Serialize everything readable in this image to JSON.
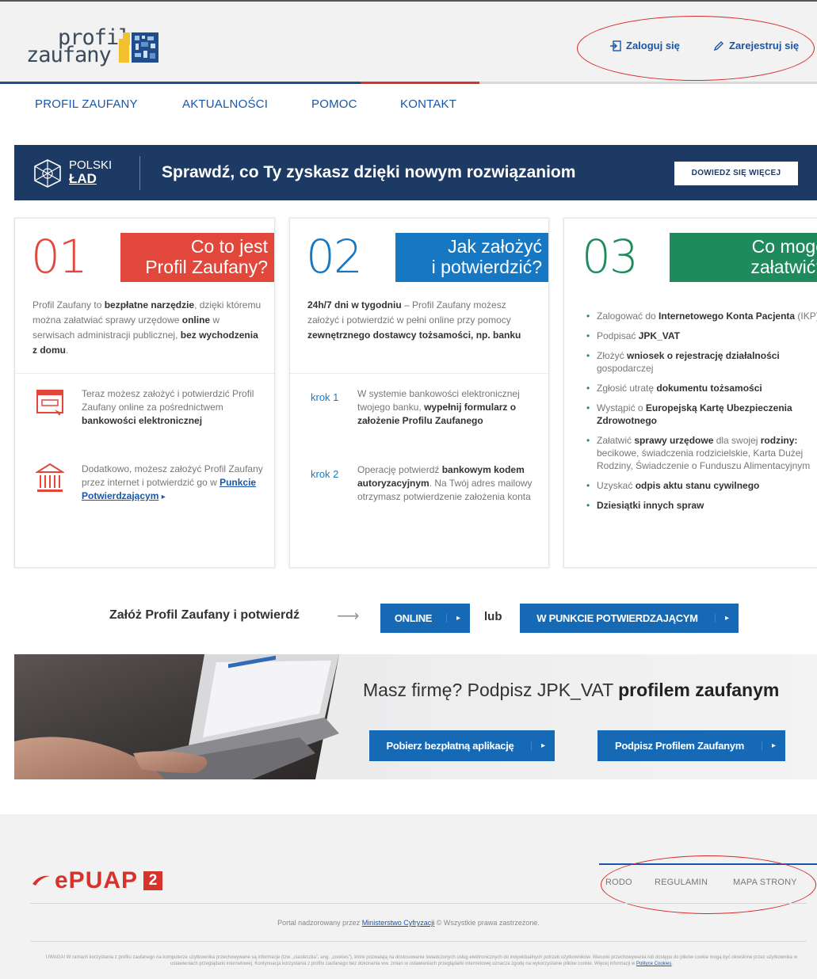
{
  "header": {
    "logo": {
      "line1": "profil",
      "line2": "zaufany"
    },
    "login": "Zaloguj się",
    "register": "Zarejestruj się"
  },
  "nav": [
    "PROFIL ZAUFANY",
    "AKTUALNOŚCI",
    "POMOC",
    "KONTAKT"
  ],
  "banner": {
    "emblem_line1": "POLSKI",
    "emblem_line2": "ŁAD",
    "text": "Sprawdź, co Ty zyskasz dzięki nowym rozwiązaniom",
    "button": "DOWIEDZ SIĘ WIĘCEJ"
  },
  "cards": {
    "c1": {
      "number": "01",
      "head1": "Co to jest",
      "head2": "Profil Zaufany?",
      "intro_a": "Profil Zaufany to ",
      "intro_b": "bezpłatne narzędzie",
      "intro_c": ", dzięki któremu można załatwiać sprawy urzędowe ",
      "intro_d": "online",
      "intro_e": " w serwisach administracji publicznej, ",
      "intro_f": "bez wychodzenia z domu",
      "intro_g": ".",
      "item1_a": "Teraz możesz założyć i potwierdzić Profil Zaufany online za pośrednictwem ",
      "item1_b": "bankowości elektronicznej",
      "item2_a": "Dodatkowo, możesz założyć Profil Zaufany przez internet i potwierdzić go w ",
      "item2_link": "Punkcie Potwierdzającym",
      "item2_arrow": "▸"
    },
    "c2": {
      "number": "02",
      "head1": "Jak założyć",
      "head2": "i potwierdzić?",
      "intro_a": "24h/7 dni w tygodniu",
      "intro_b": " – Profil Zaufany możesz założyć i potwierdzić w pełni online przy pomocy ",
      "intro_c": "zewnętrznego dostawcy tożsamości, np. banku",
      "step1_label": "krok 1",
      "step1_a": "W systemie bankowości elektronicznej twojego banku, ",
      "step1_b": "wypełnij formularz o założenie Profilu Zaufanego",
      "step2_label": "krok 2",
      "step2_a": "Operację potwierdź ",
      "step2_b": "bankowym kodem autoryzacyjnym",
      "step2_c": ". Na Twój adres mailowy otrzymasz potwierdzenie założenia konta"
    },
    "c3": {
      "number": "03",
      "head1": "Co mogę",
      "head2": "załatwić?",
      "items": [
        {
          "a": "Zalogować do ",
          "b": "Internetowego Konta Pacjenta",
          "c": " (IKP)"
        },
        {
          "a": "Podpisać ",
          "b": "JPK_VAT",
          "c": ""
        },
        {
          "a": "Złożyć ",
          "b": "wniosek o rejestrację działalności",
          "c": " gospodarczej"
        },
        {
          "a": "Zgłosić utratę ",
          "b": "dokumentu tożsamości",
          "c": ""
        },
        {
          "a": "Wystąpić o ",
          "b": "Europejską Kartę Ubezpieczenia Zdrowotnego",
          "c": ""
        },
        {
          "a": "Załatwić ",
          "b": "sprawy urzędowe",
          "c": " dla swojej "
        },
        {
          "a": "Uzyskać ",
          "b": "odpis aktu stanu cywilnego",
          "c": ""
        },
        {
          "a": "",
          "b": "Dziesiątki innych spraw",
          "c": ""
        }
      ],
      "item6_b2": "rodziny:",
      "item6_c2": " becikowe, świadczenia rodzicielskie, Karta Dużej Rodziny, Świadczenie o Funduszu Alimentacyjnym"
    }
  },
  "cta": {
    "text": "Załóż Profil Zaufany i potwierdź",
    "arrow": "⟶",
    "online": "ONLINE",
    "or": "lub",
    "punkt": "W PUNKCIE POTWIERDZAJĄCYM",
    "btn_arrow": "▸"
  },
  "promo": {
    "title_a": "Masz firmę? Podpisz JPK_VAT ",
    "title_b": "profilem zaufanym",
    "btn1": "Pobierz bezpłatną aplikację",
    "btn2": "Podpisz Profilem Zaufanym"
  },
  "footer": {
    "epuap": "ePUAP",
    "epuap_num": "2",
    "links": [
      "RODO",
      "REGULAMIN",
      "MAPA STRONY"
    ],
    "copy_a": "Portal nadzorowany przez ",
    "copy_link": "Ministerstwo Cyfryzacji",
    "copy_b": " © Wszystkie prawa zastrzeżone.",
    "cookie_a": "UWAGA! W ramach korzystania z profilu zaufanego na komputerze użytkownika przechowywane są informacje (tzw. „ciasteczka”, ang. „cookies”), które pozwalają na dostosowanie świadczonych usług elektronicznych do indywidualnych potrzeb użytkowników. Warunki przechowywania lub dostępu do plików cookie mogą być określone przez użytkownika w ustawieniach przeglądarki internetowej. Kontynuacja korzystania z profilu zaufanego bez dokonania ww. zmian w ustawieniach przeglądarki internetowej oznacza zgodę na wykorzystanie plików cookie. Więcej informacji w ",
    "cookie_link": "Polityce Cookies",
    "cookie_b": "."
  },
  "colors": {
    "brand_blue": "#1a56a8",
    "banner_navy": "#1d3a64",
    "card1_red": "#e2473c",
    "card2_blue": "#1677c2",
    "card3_green": "#1f8a5c",
    "button_blue": "#1669b4",
    "annotation_red": "#d62828"
  }
}
